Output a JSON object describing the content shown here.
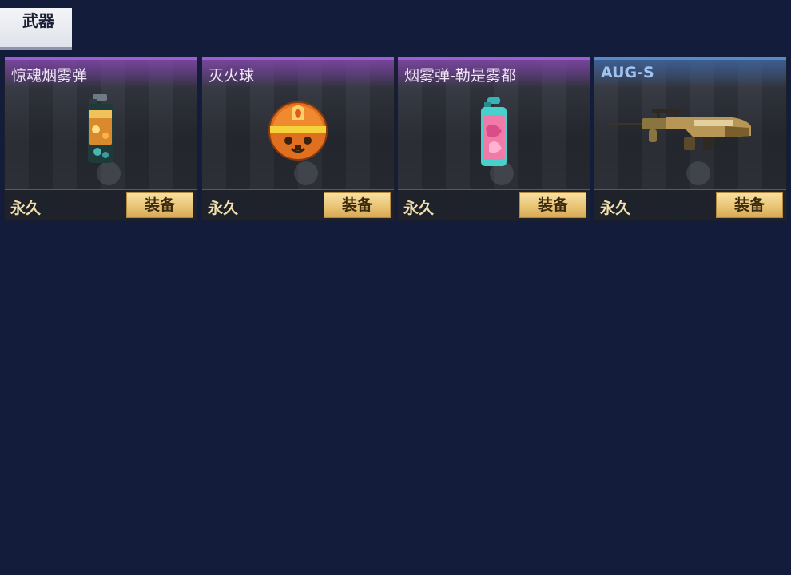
{
  "tabs": {
    "weapons_label": "武器"
  },
  "items": [
    {
      "name": "惊魂烟雾弹",
      "duration": "永久",
      "equip_label": "装备",
      "rarity": "purple",
      "icon": "smoke-grenade-icon"
    },
    {
      "name": "灭火球",
      "duration": "永久",
      "equip_label": "装备",
      "rarity": "purple",
      "icon": "fire-extinguisher-ball-icon"
    },
    {
      "name": "烟雾弹-勒是雾都",
      "duration": "永久",
      "equip_label": "装备",
      "rarity": "purple",
      "icon": "smoke-grenade-icon"
    },
    {
      "name": "AUG-S",
      "duration": "永久",
      "equip_label": "装备",
      "rarity": "blue",
      "icon": "assault-rifle-icon"
    }
  ],
  "colors": {
    "background": "#131d3b",
    "purple_rarity": "#9a5fd0",
    "blue_rarity": "#5a89c8",
    "equip_button": "#e8c271",
    "duration_text": "#f1dfae"
  }
}
